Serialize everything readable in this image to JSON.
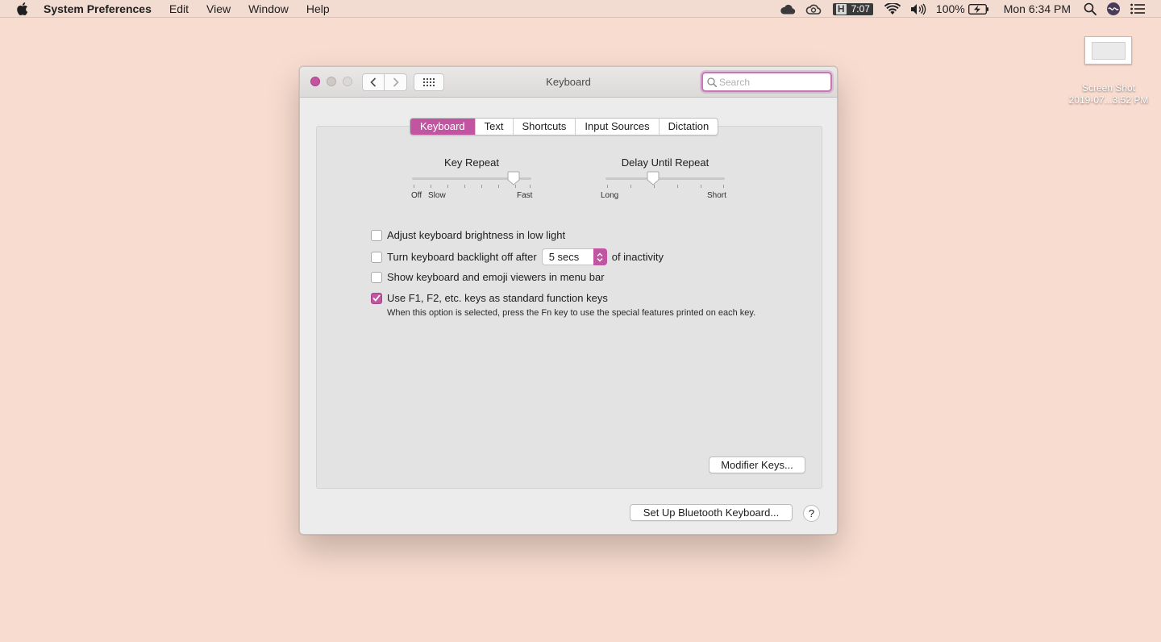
{
  "menubar": {
    "app_name": "System Preferences",
    "menus": [
      "Edit",
      "View",
      "Window",
      "Help"
    ],
    "timer_letter": "H",
    "timer_time": "7:07",
    "battery_percent": "100%",
    "clock": "Mon 6:34 PM"
  },
  "desktop": {
    "file_name_line1": "Screen Shot",
    "file_name_line2": "2019-07...3.52 PM"
  },
  "window": {
    "title": "Keyboard",
    "search_placeholder": "Search"
  },
  "tabs": [
    "Keyboard",
    "Text",
    "Shortcuts",
    "Input Sources",
    "Dictation"
  ],
  "active_tab": "Keyboard",
  "key_repeat": {
    "title": "Key Repeat",
    "label_off": "Off",
    "label_slow": "Slow",
    "label_fast": "Fast",
    "position_fraction": 0.85
  },
  "delay_until_repeat": {
    "title": "Delay Until Repeat",
    "label_long": "Long",
    "label_short": "Short",
    "position_fraction": 0.4
  },
  "options": {
    "brightness_label": "Adjust keyboard brightness in low light",
    "brightness_checked": false,
    "backlight_label_pre": "Turn keyboard backlight off after",
    "backlight_value": "5 secs",
    "backlight_label_post": "of inactivity",
    "backlight_checked": false,
    "viewers_label": "Show keyboard and emoji viewers in menu bar",
    "viewers_checked": false,
    "fn_keys_label": "Use F1, F2, etc. keys as standard function keys",
    "fn_keys_checked": true,
    "fn_keys_hint": "When this option is selected, press the Fn key to use the special features printed on each key."
  },
  "buttons": {
    "modifier_keys": "Modifier Keys...",
    "bluetooth_keyboard": "Set Up Bluetooth Keyboard...",
    "help": "?"
  },
  "colors": {
    "accent": "#c155a1",
    "desktop": "#f8dccf"
  }
}
